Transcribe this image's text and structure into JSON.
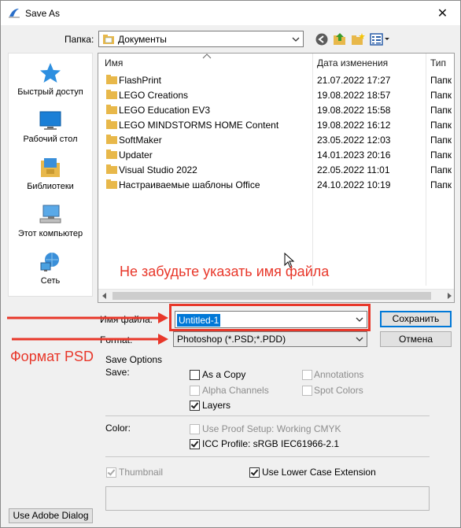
{
  "window": {
    "title": "Save As",
    "close_glyph": "✕"
  },
  "location": {
    "label": "Папка:",
    "value": "Документы"
  },
  "places": [
    {
      "label": "Быстрый доступ",
      "icon": "star-icon"
    },
    {
      "label": "Рабочий стол",
      "icon": "desktop-icon"
    },
    {
      "label": "Библиотеки",
      "icon": "library-icon"
    },
    {
      "label": "Этот компьютер",
      "icon": "computer-icon"
    },
    {
      "label": "Сеть",
      "icon": "network-icon"
    }
  ],
  "columns": {
    "name": "Имя",
    "date": "Дата изменения",
    "type": "Тип"
  },
  "files": [
    {
      "name": "FlashPrint",
      "date": "21.07.2022 17:27",
      "type": "Папк"
    },
    {
      "name": "LEGO Creations",
      "date": "19.08.2022 18:57",
      "type": "Папк"
    },
    {
      "name": "LEGO Education EV3",
      "date": "19.08.2022 15:58",
      "type": "Папк"
    },
    {
      "name": "LEGO MINDSTORMS HOME Content",
      "date": "19.08.2022 16:12",
      "type": "Папк"
    },
    {
      "name": "SoftMaker",
      "date": "23.05.2022 12:03",
      "type": "Папк"
    },
    {
      "name": "Updater",
      "date": "14.01.2023 20:16",
      "type": "Папк"
    },
    {
      "name": "Visual Studio 2022",
      "date": "22.05.2022 11:01",
      "type": "Папк"
    },
    {
      "name": "Настраиваемые шаблоны Office",
      "date": "24.10.2022 10:19",
      "type": "Папк"
    }
  ],
  "filename": {
    "label": "Имя файла:",
    "value": "Untitled-1"
  },
  "format": {
    "label": "Format:",
    "value": "Photoshop (*.PSD;*.PDD)"
  },
  "buttons": {
    "save": "Сохранить",
    "cancel": "Отмена",
    "adobe_dialog": "Use Adobe Dialog"
  },
  "save_options": {
    "title": "Save Options",
    "save_label": "Save:",
    "as_copy": "As a Copy",
    "annotations": "Annotations",
    "alpha_channels": "Alpha Channels",
    "spot_colors": "Spot Colors",
    "layers": "Layers",
    "color_label": "Color:",
    "use_proof_setup": "Use Proof Setup:  Working CMYK",
    "icc_profile": "ICC Profile:  sRGB IEC61966-2.1",
    "thumbnail": "Thumbnail",
    "lower_case": "Use Lower Case Extension"
  },
  "annotations": {
    "reminder": "Не забудьте указать имя файла",
    "format_hint": "Формат PSD"
  },
  "colors": {
    "accent": "#0078d7",
    "annotation": "#e8372a",
    "folder": "#e8b84a"
  }
}
